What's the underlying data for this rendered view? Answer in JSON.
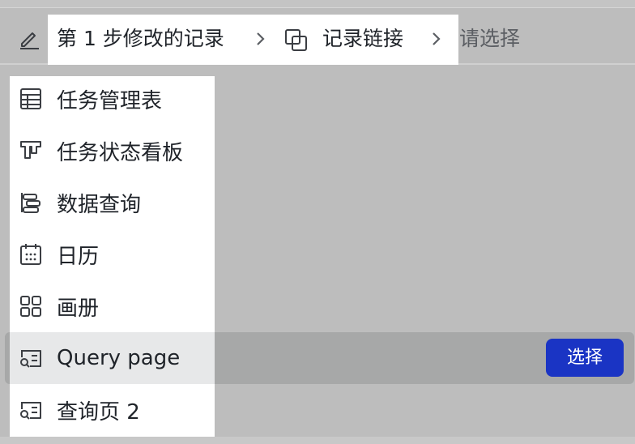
{
  "header": {
    "breadcrumb": [
      {
        "label": "第 1 步修改的记录"
      },
      {
        "label": "记录链接"
      },
      {
        "label": "请选择"
      }
    ]
  },
  "menu": {
    "items": [
      {
        "label": "任务管理表",
        "icon": "table-icon"
      },
      {
        "label": "任务状态看板",
        "icon": "kanban-icon"
      },
      {
        "label": "数据查询",
        "icon": "gantt-icon"
      },
      {
        "label": "日历",
        "icon": "calendar-icon"
      },
      {
        "label": "画册",
        "icon": "gallery-icon"
      },
      {
        "label": "Query page",
        "icon": "query-page-icon"
      },
      {
        "label": "查询页 2",
        "icon": "query-page-icon"
      }
    ]
  },
  "row_action": {
    "select_label": "选择"
  },
  "colors": {
    "accent": "#1a34c4",
    "hover": "#e7e8e9"
  }
}
